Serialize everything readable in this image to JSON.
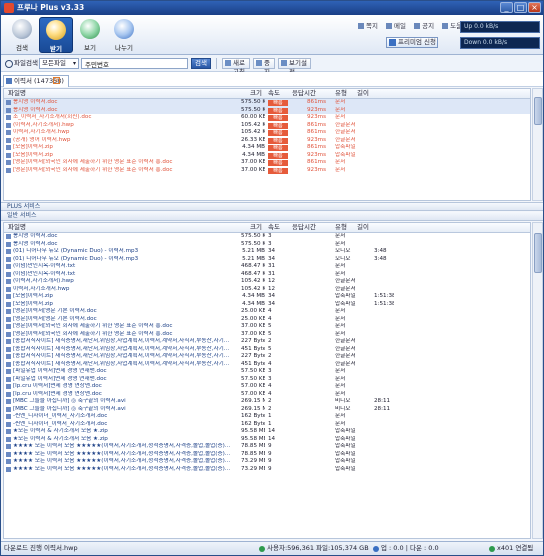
{
  "window": {
    "title": "프루나 Plus v3.33",
    "min": "_",
    "max": "□",
    "close": "×"
  },
  "nav": [
    {
      "label": "검색",
      "icon": "search-icon"
    },
    {
      "label": "받기",
      "icon": "download-icon"
    },
    {
      "label": "보기",
      "icon": "view-icon"
    },
    {
      "label": "나누기",
      "icon": "share-icon"
    }
  ],
  "top_links": [
    "쪽지",
    "메일",
    "공지",
    "도움말"
  ],
  "premium_label": "프리미엄 신청",
  "speed": {
    "up": "Up 0.0 kB/s",
    "down": "Down 0.0 kB/s"
  },
  "search": {
    "label": "파일검색",
    "scope": "모든파일",
    "query": "주민번호",
    "button": "검색"
  },
  "toolbar2": {
    "refresh": "새로고침",
    "stop": "중지",
    "settings": "보기설정"
  },
  "result_tab": {
    "label": "이력서 (147358)",
    "close": "×"
  },
  "columns": {
    "name": "파일명",
    "size": "크기",
    "speed": "속도",
    "reply": "응답시간",
    "type": "유형",
    "length": "길이"
  },
  "top_rows": [
    {
      "name": "봉지영 이력서.doc",
      "size": "575.50 KB",
      "speed": "빠름",
      "time": "861ms",
      "type": "문서",
      "len": "",
      "sel": true
    },
    {
      "name": "봉지영 이력서.doc",
      "size": "575.50 KB",
      "speed": "빠름",
      "time": "923ms",
      "type": "문서",
      "len": "",
      "sel": true
    },
    {
      "name": "조_이력서_자기소개서(회신).doc",
      "size": "60.00 KB",
      "speed": "빠름",
      "time": "923ms",
      "type": "문서",
      "len": ""
    },
    {
      "name": "(이력서,자기소개서).hwp",
      "size": "105.42 KB",
      "speed": "빠름",
      "time": "861ms",
      "type": "한글문서",
      "len": ""
    },
    {
      "name": "이력서,자기소개서.hwp",
      "size": "105.42 KB",
      "speed": "빠름",
      "time": "861ms",
      "type": "한글문서",
      "len": ""
    },
    {
      "name": "(공개) 영어 이력서.hwp",
      "size": "26.33 KB",
      "speed": "빠름",
      "time": "923ms",
      "type": "한글문서",
      "len": ""
    },
    {
      "name": "[모음]이력서.zip",
      "size": "4.34 MB",
      "speed": "빠름",
      "time": "861ms",
      "type": "압축파일",
      "len": ""
    },
    {
      "name": "[모음]이력서.zip",
      "size": "4.34 MB",
      "speed": "빠름",
      "time": "923ms",
      "type": "압축파일",
      "len": ""
    },
    {
      "name": "[영문]이력서[외국인 회사에 제출하기 위한 영문 표준 이력서 홍.doc",
      "size": "37.00 KB",
      "speed": "빠름",
      "time": "861ms",
      "type": "문서",
      "len": ""
    },
    {
      "name": "[영문]이력서[외국인 회사에 제출하기 위한 영문 표준 이력서 홍.doc",
      "size": "37.00 KB",
      "speed": "빠름",
      "time": "923ms",
      "type": "문서",
      "len": ""
    }
  ],
  "split1": "PLUS 서비스",
  "split2": "일반 서비스",
  "bottom_rows": [
    {
      "name": "봉지영 이력서.doc",
      "size": "575.50 KB",
      "speed": "3",
      "type": "문서",
      "len": ""
    },
    {
      "name": "봉지영 이력서.doc",
      "size": "575.50 KB",
      "speed": "3",
      "type": "문서",
      "len": ""
    },
    {
      "name": "(01) 디어나무 듀오 (Dynamic Duo) - 이력서.mp3",
      "size": "5.21 MB",
      "speed": "34",
      "type": "오디오",
      "len": "3:48"
    },
    {
      "name": "(01) 디어나무 듀오 (Dynamic Duo) - 이력서.mp3",
      "size": "5.21 MB",
      "speed": "34",
      "type": "오디오",
      "len": "3:48"
    },
    {
      "name": "(이념)만인지옥-이력서.txt",
      "size": "468.47 KB",
      "speed": "31",
      "type": "문서",
      "len": ""
    },
    {
      "name": "(이념)만인지옥-이력서.txt",
      "size": "468.47 KB",
      "speed": "31",
      "type": "문서",
      "len": ""
    },
    {
      "name": "(이력서,자기소개서).hwp",
      "size": "105.42 KB",
      "speed": "12",
      "type": "한글문서",
      "len": ""
    },
    {
      "name": "이력서,자기소개서.hwp",
      "size": "105.42 KB",
      "speed": "12",
      "type": "한글문서",
      "len": ""
    },
    {
      "name": "[모음]이력서.zip",
      "size": "4.34 MB",
      "speed": "34",
      "type": "압축파일",
      "len": "1:51:38"
    },
    {
      "name": "[모음]이력서.zip",
      "size": "4.34 MB",
      "speed": "34",
      "type": "압축파일",
      "len": "1:51:38"
    },
    {
      "name": "[영문]이력서[영문 기본 이력서.doc",
      "size": "25.00 KB",
      "speed": "4",
      "type": "문서",
      "len": ""
    },
    {
      "name": "[영문]이력서[영문 기본 이력서.doc",
      "size": "25.00 KB",
      "speed": "4",
      "type": "문서",
      "len": ""
    },
    {
      "name": "[영문]이력서[외국인 회사에 제출하기 위한 영문 표준 이력서 홍.doc",
      "size": "37.00 KB",
      "speed": "5",
      "type": "문서",
      "len": ""
    },
    {
      "name": "[영문]이력서[외국인 회사에 제출하기 위한 영문 표준 이력서 홍.doc",
      "size": "37.00 KB",
      "speed": "5",
      "type": "문서",
      "len": ""
    },
    {
      "name": "[종합서식사이트] 재직증명서,재단서,위임장,사업계획서,이력서,계약서,사직서,부동산,자기...",
      "size": "227 Bytes",
      "speed": "2",
      "type": "한글문서",
      "len": ""
    },
    {
      "name": "[종합서식사이트] 재직증명서,재단서,위임장,사업계획서,이력서,계약서,사직서,부동산,자기...",
      "size": "451 Bytes",
      "speed": "5",
      "type": "한글문서",
      "len": ""
    },
    {
      "name": "[종합서식사이트] 재직증명서,재단서,위임장,사업계획서,이력서,계약서,사직서,부동산,자기...",
      "size": "227 Bytes",
      "speed": "2",
      "type": "한글문서",
      "len": ""
    },
    {
      "name": "[종합서식사이트] 재직증명서,재단서,위임장,사업계획서,이력서,계약서,사직서,부동산,자기...",
      "size": "451 Bytes",
      "speed": "4",
      "type": "한글문서",
      "len": ""
    },
    {
      "name": "[파일유업 이력서]면세 경영 연재맨.doc",
      "size": "57.50 KB",
      "speed": "3",
      "type": "문서",
      "len": ""
    },
    {
      "name": "[파일유업 이력서]면세 경영 연재맨.doc",
      "size": "57.50 KB",
      "speed": "3",
      "type": "문서",
      "len": ""
    },
    {
      "name": "[lp.cru 이력서]면세 경영 연상맨.doc",
      "size": "57.00 KB",
      "speed": "4",
      "type": "문서",
      "len": ""
    },
    {
      "name": "[lp.cru 이력서]면세 경영 연상맨.doc",
      "size": "57.00 KB",
      "speed": "4",
      "type": "문서",
      "len": ""
    },
    {
      "name": "[MBC 그들을 아십니까] ◎ 축구끝의 이력서.avi",
      "size": "269.15 MB",
      "speed": "2",
      "type": "비디오",
      "len": "28:11"
    },
    {
      "name": "[MBC 그들을 아십니까] ◎ 축구끝의 이력서.avi",
      "size": "269.15 MB",
      "speed": "2",
      "type": "비디오",
      "len": "28:11"
    },
    {
      "name": "-씬엔_디자이너_이력서_자기소개서.doc",
      "size": "162 Bytes",
      "speed": "1",
      "type": "문서",
      "len": ""
    },
    {
      "name": "-씬엔_디자이너_이력서_자기소개서.doc",
      "size": "162 Bytes",
      "speed": "1",
      "type": "문서",
      "len": ""
    },
    {
      "name": "★모든 이력서 & 자기소개서 모음 ★.zip",
      "size": "95.58 MB",
      "speed": "14",
      "type": "압축파일",
      "len": ""
    },
    {
      "name": "★모든 이력서 & 자기소개서 모음 ★.zip",
      "size": "95.58 MB",
      "speed": "14",
      "type": "압축파일",
      "len": ""
    },
    {
      "name": "★★★★ 모든 이력서 모음 ★★★★★(이력서,자기소개서,성적증명서,자격증,졸업,졸업(증)...",
      "size": "78.85 MB",
      "speed": "9",
      "type": "압축파일",
      "len": ""
    },
    {
      "name": "★★★★ 모든 이력서 모음 ★★★★★(이력서,자기소개서,성적증명서,자격증,졸업,졸업(증)...",
      "size": "78.85 MB",
      "speed": "9",
      "type": "압축파일",
      "len": ""
    },
    {
      "name": "★★★★ 모든 이력서 모음 ★★★★★(이력서,자기소개서,성적증명서,자격증,졸업,졸업(증)...",
      "size": "73.29 MB",
      "speed": "9",
      "type": "압축파일",
      "len": ""
    },
    {
      "name": "★★★★ 모든 이력서 모음 ★★★★★(이력서,자기소개서,성적증명서,자격증,졸업,졸업(증)...",
      "size": "73.29 MB",
      "speed": "9",
      "type": "압축파일",
      "len": ""
    }
  ],
  "status": {
    "file": "다운로드 진행 이력서.hwp",
    "usage": "사용자:596,361 파일:105,374 GB",
    "io": "업 : 0.0 | 다운 : 0.0",
    "online": "x401 연결됨"
  },
  "accent": "#2c6ac4",
  "fast_badge_color": "#e65b3b"
}
